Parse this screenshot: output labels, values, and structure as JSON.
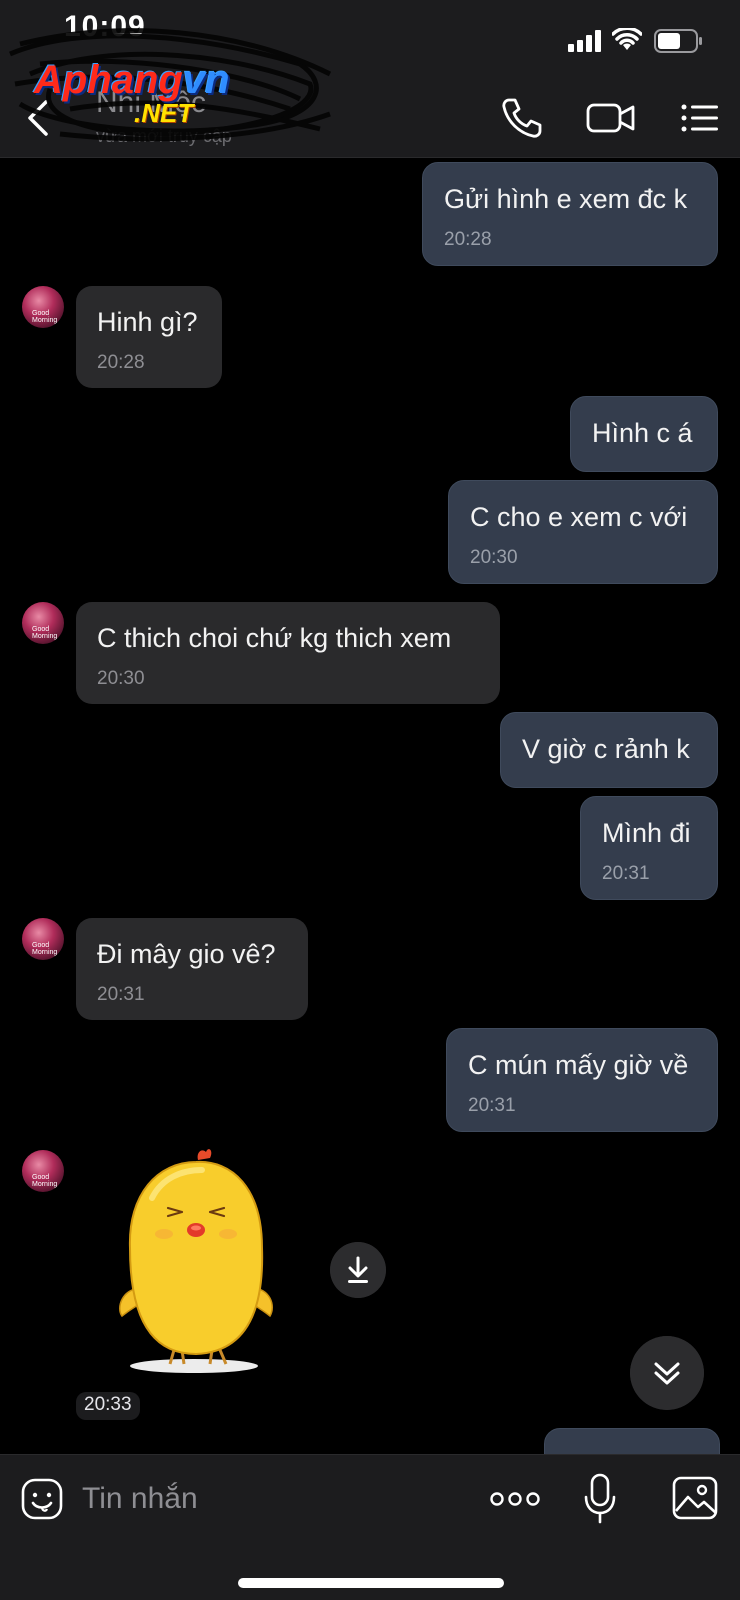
{
  "status_bar": {
    "time": "10:09"
  },
  "header": {
    "contact_name": "Nhi Mộc",
    "contact_status": "vừa mới truy cập",
    "watermark_logo": {
      "main_red": "Aphang",
      "main_blue": "vn",
      "sub": ".NET"
    },
    "icons": [
      "back-icon",
      "phone-icon",
      "video-camera-icon",
      "menu-list-icon"
    ]
  },
  "messages": [
    {
      "dir": "out",
      "text": "Gửi hình e xem đc k",
      "time": "20:28"
    },
    {
      "dir": "in",
      "text": "Hinh gì?",
      "time": "20:28"
    },
    {
      "dir": "out",
      "text": "Hình c á",
      "time": ""
    },
    {
      "dir": "out",
      "text": "C cho e xem c với",
      "time": "20:30"
    },
    {
      "dir": "in",
      "text": "C thich choi chứ kg thich xem",
      "time": "20:30"
    },
    {
      "dir": "out",
      "text": "V giờ c rảnh k",
      "time": ""
    },
    {
      "dir": "out",
      "text": "Mình đi",
      "time": "20:31"
    },
    {
      "dir": "in",
      "text": "Đi mây gio vê?",
      "time": "20:31"
    },
    {
      "dir": "out",
      "text": "C mún mấy giờ về",
      "time": "20:31"
    }
  ],
  "avatar_text": "Good Morning",
  "sticker": {
    "subject": "yellow chick sticker",
    "time": "20:33"
  },
  "input_bar": {
    "placeholder": "Tin nhắn",
    "icons": [
      "sticker-emoji-icon",
      "more-dots-icon",
      "microphone-icon",
      "image-gallery-icon"
    ]
  },
  "colors": {
    "outgoing_bubble": "#343d4d",
    "incoming_bubble": "#2a2a2c",
    "background": "#000000",
    "bar": "#1c1c1e"
  }
}
